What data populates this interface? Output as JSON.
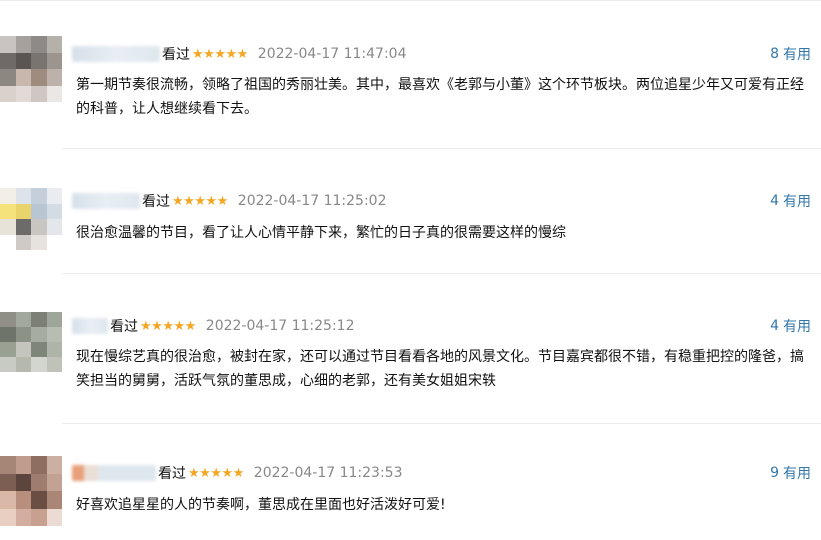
{
  "reviews": [
    {
      "watched": "看过",
      "rating": 5,
      "date": "2022-04-17 11:47:04",
      "useful_count": "8",
      "useful_label": "有用",
      "text": "第一期节奏很流畅，领略了祖国的秀丽壮美。其中，最喜欢《老郭与小董》这个环节板块。两位追星少年又可爱有正经的科普，让人想继续看下去。"
    },
    {
      "watched": "看过",
      "rating": 5,
      "date": "2022-04-17 11:25:02",
      "useful_count": "4",
      "useful_label": "有用",
      "text": "很治愈温馨的节目，看了让人心情平静下来，繁忙的日子真的很需要这样的慢综"
    },
    {
      "watched": "看过",
      "rating": 5,
      "date": "2022-04-17 11:25:12",
      "useful_count": "4",
      "useful_label": "有用",
      "text": "现在慢综艺真的很治愈，被封在家，还可以通过节目看看各地的风景文化。节目嘉宾都很不错，有稳重把控的隆爸，搞笑担当的舅舅，活跃气氛的董思成，心细的老郭，还有美女姐姐宋轶"
    },
    {
      "watched": "看过",
      "rating": 5,
      "date": "2022-04-17 11:23:53",
      "useful_count": "9",
      "useful_label": "有用",
      "text": "好喜欢追星星的人的节奏啊，董思成在里面也好活泼好可爱!"
    }
  ],
  "colors": {
    "star": "#f5a623",
    "link": "#3377aa",
    "date": "#888888",
    "divider": "#ececec"
  },
  "icons": {
    "star": "star-icon"
  }
}
